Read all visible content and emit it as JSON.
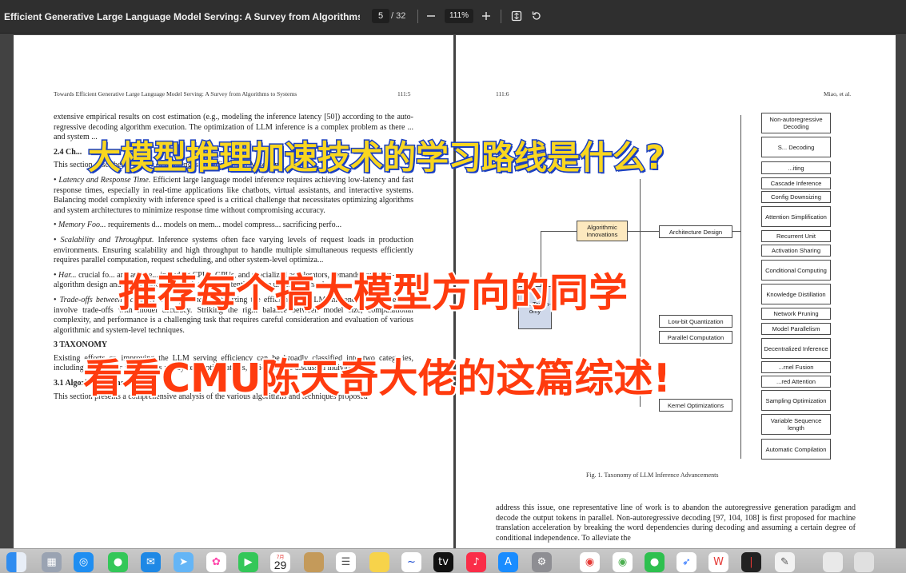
{
  "toolbar": {
    "doc_title": "Efficient Generative Large Language Model Serving: A Survey from Algorithms to Syst...",
    "page_current": "5",
    "page_total": "/ 32",
    "zoom": "111%",
    "zoom_out_icon": "minus-icon",
    "zoom_in_icon": "plus-icon",
    "fit_icon": "fit-page-icon",
    "rotate_icon": "rotate-icon"
  },
  "left_page": {
    "running_head": "Towards Efficient Generative Large Language Model Serving: A Survey from Algorithms to Systems",
    "page_number": "111:5",
    "p1": "extensive empirical results on cost estimation (e.g., modeling the inference latency [50]) according to the auto-regressive decoding algorithm execution. The optimization of LLM inference is a complex problem as there ... and system ...",
    "section_24": "2.4 Ch...",
    "p2": "This section describes a variety of challenges for efficient LLM serving.",
    "b1_head": "Latency and Response Time.",
    "b1": "Efficient large language model inference requires achieving low-latency and fast response times, especially in real-time applications like chatbots, virtual assistants, and interactive systems. Balancing model complexity with inference speed is a critical challenge that necessitates optimizing algorithms and system architectures to minimize response time without compromising accuracy.",
    "b2_head": "Memory Foo...",
    "b2": "requirements d... models on mem... model compress... sacrificing perfo...",
    "b3_head": "Scalability and Throughput.",
    "b3": "Inference systems often face varying levels of request loads in production environments. Ensuring scalability and high throughput to handle multiple simultaneous requests efficiently requires parallel computation, request scheduling, and other system-level optimiza...",
    "b4_head": "Har...",
    "b4": "crucial fo... and archite... including CPUs, GPUs, and specialized accelerators, demands hardware-aware algorithm design and optimization to exploit the full potential of the underlying hardware.",
    "b5_head": "Trade-offs between Accuracy and Efficiency.",
    "b5": "Optimizing the efficiency of LLM inference may sometimes involve trade-offs with model accuracy. Striking the right balance between model size, computational complexity, and performance is a challenging task that requires careful consideration and evaluation of various algorithmic and system-level techniques.",
    "section_3": "3 TAXONOMY",
    "p3": "Existing efforts on improving the LLM serving efficiency can be broadly classified into two categories, including algorithmic innovations and system optimizations, which will be discussed individually.",
    "section_31": "3.1 Algorithmic Innovation",
    "p4": "This section presents a comprehensive analysis of the various algorithms and techniques proposed"
  },
  "right_page": {
    "page_number": "111:6",
    "authors": "Miao, et al.",
    "figure": {
      "root": "LL... Taxon- omy",
      "l1_algo": "Algorithmic Innovations",
      "l1_sys": "...ion",
      "l2_arch": "Architecture Design",
      "l2_model": "Mod... ...n",
      "l2_lowbit": "Low-bit Quantization",
      "l2_parallel": "Parallel Computation",
      "l2_kernel": "Kernel Optimizations",
      "leaves": [
        "Non-autoregressive Decoding",
        "S... Decoding",
        "...iting",
        "Cascade Inference",
        "Config Downsizing",
        "Attention Simplification",
        "Recurrent Unit",
        "Activation Sharing",
        "Conditional Computing",
        "Knowledge Distillation",
        "Network Pruning",
        "Model Parallelism",
        "Decentralized Inference",
        "...rnel Fusion",
        "...red Attention",
        "Sampling Optimization",
        "Variable Sequence length",
        "Automatic Compilation"
      ],
      "caption": "Fig. 1. Taxonomy of LLM Inference Advancements"
    },
    "p1": "address this issue, one representative line of work is to abandon the autoregressive generation paradigm and decode the output tokens in parallel. Non-autoregressive decoding [97, 104, 108] is first proposed for machine translation acceleration by breaking the word dependencies during decoding and assuming a certain degree of conditional independence. To alleviate the"
  },
  "overlays": {
    "line1": "大模型推理加速技术的学习路线是什么?",
    "line2": "推荐每个搞大模型方向的同学",
    "line3": "看看CMU陈天奇大佬的这篇综述!"
  },
  "dock": {
    "calendar_month": "7月",
    "calendar_day": "29",
    "apps": [
      "finder-icon",
      "launchpad-icon",
      "safari-icon",
      "messages-icon",
      "mail-icon",
      "maps-icon",
      "photos-icon",
      "facetime-icon",
      "calendar-icon",
      "notes-icon",
      "reminders-icon",
      "stickies-icon",
      "freeform-icon",
      "appletv-icon",
      "music-icon",
      "appstore-icon",
      "settings-icon",
      "chrome-icon",
      "browser-icon",
      "wechat-icon",
      "feishu-icon",
      "wps-icon",
      "media-icon",
      "paper-icon",
      "preview-icon",
      "trash-icon"
    ]
  }
}
